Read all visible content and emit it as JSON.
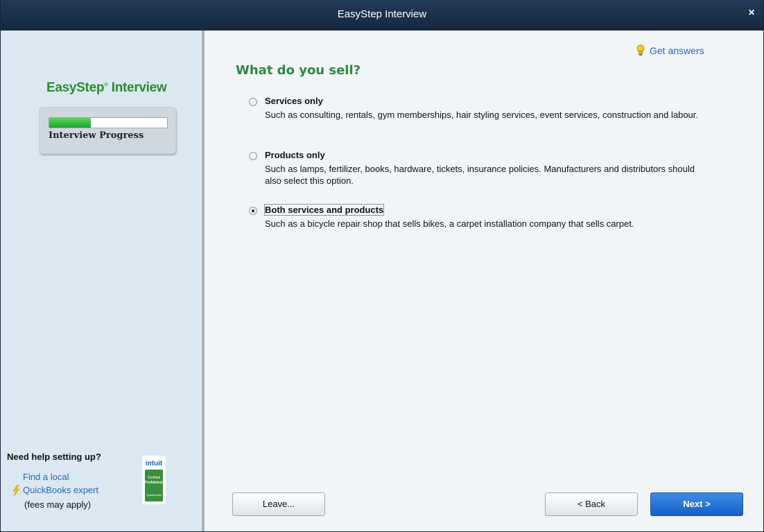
{
  "window": {
    "title": "EasyStep Interview",
    "close_glyph": "×"
  },
  "sidebar": {
    "title_main": "EasyStep",
    "title_registered": "®",
    "title_suffix": " Interview",
    "progress": {
      "label": "Interview Progress",
      "fraction": 0.35,
      "fill_color": "#2fbf3f"
    },
    "help": {
      "heading": "Need help setting up?",
      "link_line1": "Find a local",
      "link_line2": "QuickBooks expert",
      "fees_note": "(fees may apply)",
      "badge": {
        "brand": "intuit",
        "line1": "Certified",
        "line2": "ProAdvisor",
        "line3": "QuickBooks"
      }
    }
  },
  "content": {
    "get_answers": "Get answers",
    "question": "What do you sell?",
    "options": [
      {
        "label": "Services only",
        "description": "Such as consulting, rentals, gym memberships, hair styling services, event services, construction and labour.",
        "selected": false
      },
      {
        "label": "Products only",
        "description": "Such as lamps, fertilizer, books, hardware, tickets, insurance policies. Manufacturers and distributors should also select this option.",
        "selected": false
      },
      {
        "label": "Both services and products",
        "description": "Such as a bicycle repair shop that sells bikes, a carpet installation company that sells carpet.",
        "selected": true
      }
    ]
  },
  "buttons": {
    "leave": "Leave...",
    "back": "< Back",
    "next": "Next >"
  },
  "colors": {
    "accent_green": "#2b8a3e",
    "link_blue": "#2466b8",
    "titlebar": "#1d3350",
    "sidebar_bg": "#dce8f1",
    "next_button": "#2a78d8"
  }
}
